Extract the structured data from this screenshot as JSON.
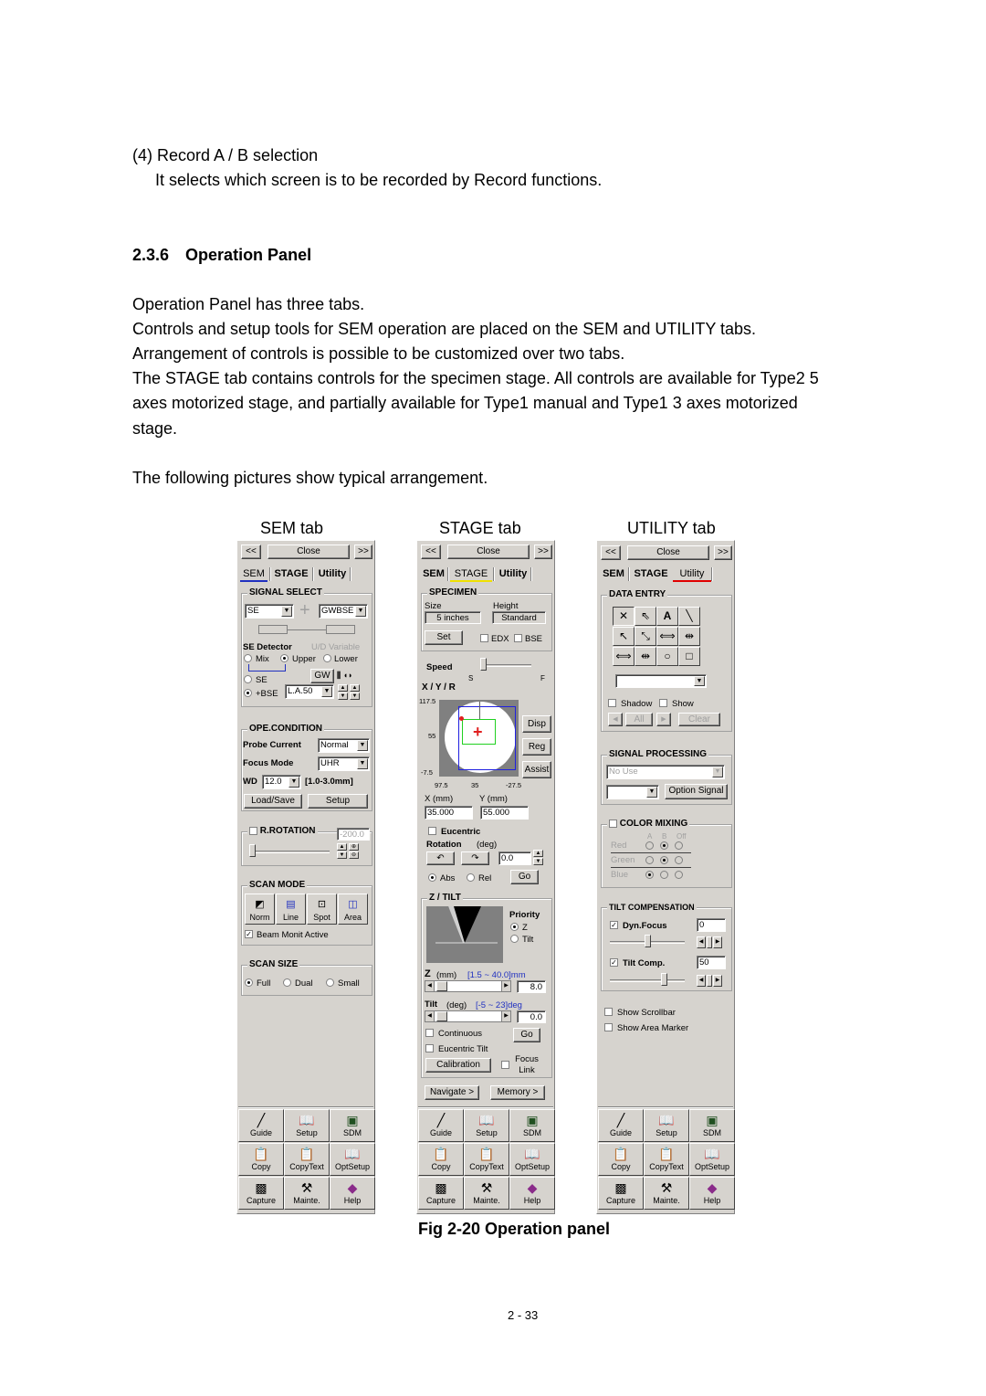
{
  "doc": {
    "item_heading": "(4) Record A / B selection",
    "item_desc": "It selects which screen is to be recorded by Record functions.",
    "section_number": "2.3.6",
    "section_title": "Operation Panel",
    "paragraphs": [
      "Operation Panel has three tabs.",
      "Controls and setup tools for SEM operation are placed on the SEM and UTILITY tabs.",
      "Arrangement of controls is possible to be customized over two tabs.",
      "The STAGE tab contains controls for the specimen stage. All controls are available for Type2 5",
      "axes motorized stage, and partially available for Type1 manual and Type1 3 axes motorized",
      "stage."
    ],
    "pictures_intro": "The following pictures show typical arrangement.",
    "panel_captions": [
      "SEM tab",
      "STAGE tab",
      "UTILITY tab"
    ],
    "figure_caption": "Fig 2-20 Operation panel",
    "page_number": "2 - 33"
  },
  "common": {
    "prev_label": "<<",
    "close_label": "Close",
    "next_label": ">>",
    "tabs": [
      "SEM",
      "STAGE",
      "Utility"
    ],
    "tab_accent_colors": {
      "SEM": "#2030c0",
      "STAGE": "#f0e000",
      "Utility": "#e00000"
    },
    "bottom_buttons": [
      {
        "label": "Guide",
        "icon": "ruler-icon"
      },
      {
        "label": "Setup",
        "icon": "book-pen-icon"
      },
      {
        "label": "SDM",
        "icon": "windows-icon"
      },
      {
        "label": "Copy",
        "icon": "clipboard-icon"
      },
      {
        "label": "CopyText",
        "icon": "clipboard-text-icon"
      },
      {
        "label": "OptSetup",
        "icon": "book-pen-icon"
      },
      {
        "label": "Capture",
        "icon": "capture-icon"
      },
      {
        "label": "Mainte.",
        "icon": "wrench-icon"
      },
      {
        "label": "Help",
        "icon": "help-book-icon"
      }
    ]
  },
  "sem": {
    "signal_select": {
      "title": "SIGNAL SELECT",
      "left_signal": "SE",
      "right_signal": "GWBSE",
      "se_detector_label": "SE Detector",
      "ud_variable_label": "U/D Variable",
      "radios_top": [
        "Mix",
        "Upper",
        "Lower"
      ],
      "radios_top_selected": "Upper",
      "radios_bottom": [
        "SE",
        "+BSE"
      ],
      "radios_bottom_selected": "+BSE",
      "gw_button": "GW",
      "bse_mode": "L.A.50"
    },
    "ope_condition": {
      "title": "OPE.CONDITION",
      "probe_current_label": "Probe Current",
      "probe_current": "Normal",
      "focus_mode_label": "Focus Mode",
      "focus_mode": "UHR",
      "wd_label": "WD",
      "wd_value": "12.0",
      "wd_range": "[1.0-3.0mm]",
      "load_save": "Load/Save",
      "setup": "Setup"
    },
    "r_rotation": {
      "title": "R.ROTATION",
      "value": "-200.0",
      "checked": false
    },
    "scan_mode": {
      "title": "SCAN MODE",
      "buttons": [
        "Norm",
        "Line",
        "Spot",
        "Area"
      ],
      "beam_monit_label": "Beam Monit Active",
      "beam_monit_checked": true
    },
    "scan_size": {
      "title": "SCAN SIZE",
      "options": [
        "Full",
        "Dual",
        "Small"
      ],
      "selected": "Full"
    }
  },
  "stage": {
    "specimen": {
      "title": "SPECIMEN",
      "size_label": "Size",
      "size_value": "5 inches",
      "height_label": "Height",
      "height_value": "Standard",
      "set_button": "Set",
      "edx_label": "EDX",
      "bse_label": "BSE"
    },
    "speed": {
      "label": "Speed",
      "min_label": "S",
      "max_label": "F",
      "level_fraction": 0.0
    },
    "xyr": {
      "title": "X / Y / R",
      "y_ticks": [
        "117.5",
        "55",
        "-7.5"
      ],
      "x_ticks": [
        "97.5",
        "35",
        "-27.5"
      ],
      "disp_button": "Disp",
      "reg_button": "Reg",
      "assist_button": "Assist",
      "x_label": "X (mm)",
      "y_label": "Y (mm)",
      "x_value": "35.000",
      "y_value": "55.000",
      "eucentric_label": "Eucentric",
      "rotation_label": "Rotation",
      "rotation_unit": "(deg)",
      "rotation_value": "0.0",
      "abs_label": "Abs",
      "rel_label": "Rel",
      "mode_selected": "Abs",
      "go_button": "Go"
    },
    "z_tilt": {
      "title": "Z / TILT",
      "priority_label": "Priority",
      "priority_options": [
        "Z",
        "Tilt"
      ],
      "priority_selected": "Z",
      "z_label": "Z",
      "z_unit": "(mm)",
      "z_range": "[1.5 ~ 40.0]mm",
      "z_value": "8.0",
      "tilt_label": "Tilt",
      "tilt_unit": "(deg)",
      "tilt_range": "[-5 ~ 23]deg",
      "tilt_value": "0.0",
      "continuous_label": "Continuous",
      "go_button": "Go",
      "eucentric_tilt_label": "Eucentric Tilt",
      "calibration_button": "Calibration",
      "focus_link_label": "Focus Link"
    },
    "navigate_button": "Navigate >",
    "memory_button": "Memory >"
  },
  "utility": {
    "data_entry": {
      "title": "DATA ENTRY",
      "tools": [
        "cross-icon",
        "pointer-arrow-icon",
        "text-a-icon",
        "line-icon",
        "arrow-icon",
        "double-arrow-icon",
        "dimension-icon",
        "inner-dimension-icon",
        "dimension-length-icon",
        "inner-dimension-length-icon",
        "ellipse-icon",
        "rectangle-icon"
      ],
      "tool_glyphs": [
        "✕",
        "⇖",
        "A",
        "╲",
        "↖",
        "⤡",
        "⟺",
        "⇹",
        "⟺",
        "⇹",
        "○",
        "□"
      ],
      "dropdown_value": "",
      "shadow_label": "Shadow",
      "show_label": "Show",
      "all_button": "All",
      "clear_button": "Clear"
    },
    "signal_processing": {
      "title": "SIGNAL PROCESSING",
      "mode": "No Use",
      "sub_mode": "",
      "option_signal_button": "Option Signal"
    },
    "color_mixing": {
      "title": "COLOR MIXING",
      "columns": [
        "A",
        "B",
        "Off"
      ],
      "rows": [
        {
          "label": "Red",
          "selected": "B"
        },
        {
          "label": "Green",
          "selected": "B"
        },
        {
          "label": "Blue",
          "selected": "A"
        }
      ]
    },
    "tilt_compensation": {
      "title": "TILT COMPENSATION",
      "dyn_focus_label": "Dyn.Focus",
      "dyn_focus_value": "0",
      "dyn_focus_checked": true,
      "tilt_comp_label": "Tilt Comp.",
      "tilt_comp_value": "50",
      "tilt_comp_checked": true
    },
    "show_scrollbar_label": "Show Scrollbar",
    "show_area_marker_label": "Show Area Marker"
  }
}
